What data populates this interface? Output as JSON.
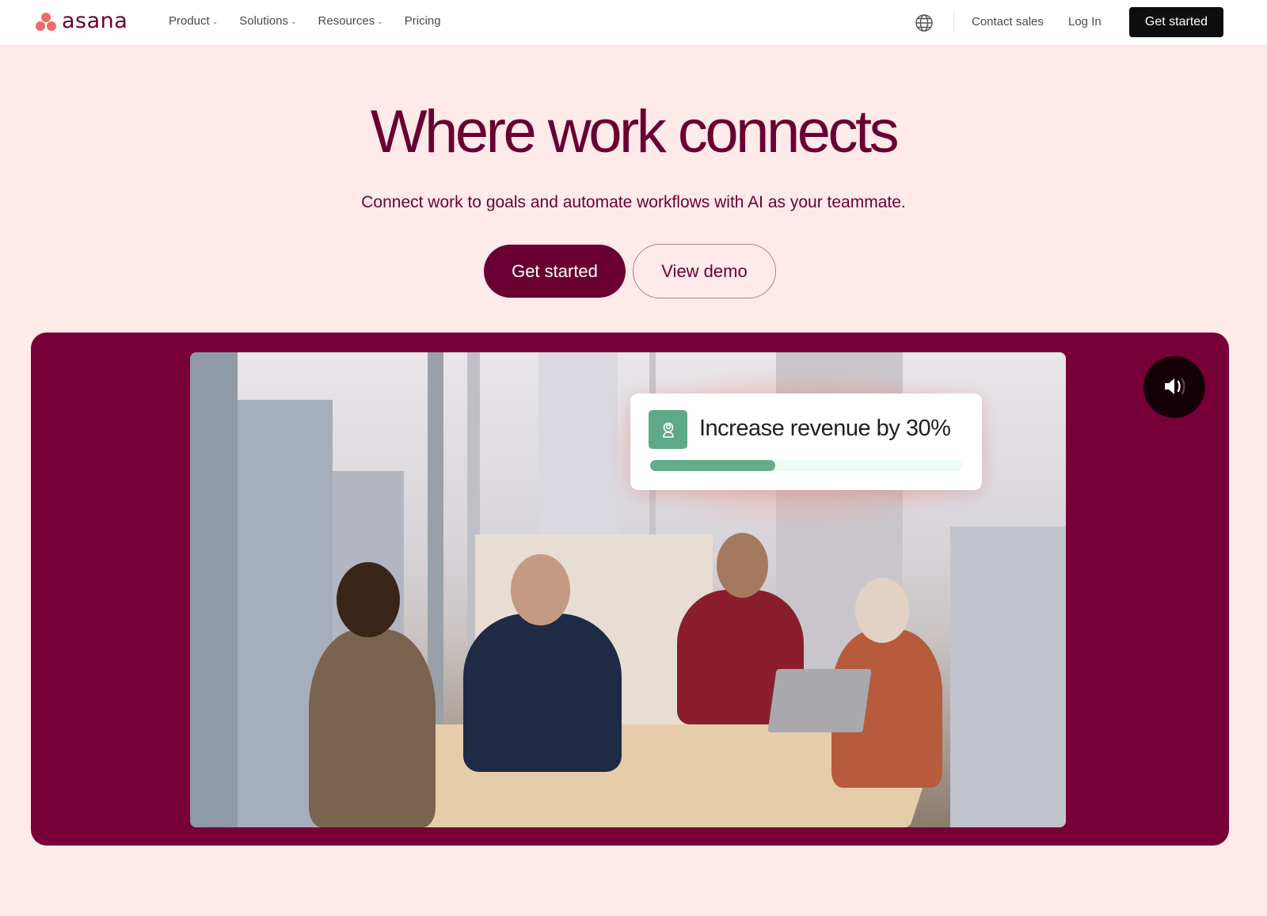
{
  "nav": {
    "brand": "asana",
    "links": [
      {
        "label": "Product",
        "has_dropdown": true
      },
      {
        "label": "Solutions",
        "has_dropdown": true
      },
      {
        "label": "Resources",
        "has_dropdown": true
      },
      {
        "label": "Pricing",
        "has_dropdown": false
      }
    ],
    "language_icon": "globe-icon",
    "contact_sales": "Contact sales",
    "log_in": "Log In",
    "cta": "Get started"
  },
  "hero": {
    "title": "Where work connects",
    "subtitle": "Connect work to goals and automate workflows with AI as your teammate.",
    "primary_cta": "Get started",
    "secondary_cta": "View demo"
  },
  "video": {
    "goal_card": {
      "icon": "goal-person-icon",
      "text": "Increase revenue by 30%",
      "progress_fraction": 0.4
    },
    "sound_icon": "speaker-volume-icon"
  },
  "colors": {
    "brand_plum": "#690031",
    "panel_plum": "#770038",
    "hero_bg": "#ffeaea",
    "logo_coral": "#f06a6a",
    "goal_green": "#63ab8b",
    "nav_cta_bg": "#0d0e10"
  }
}
